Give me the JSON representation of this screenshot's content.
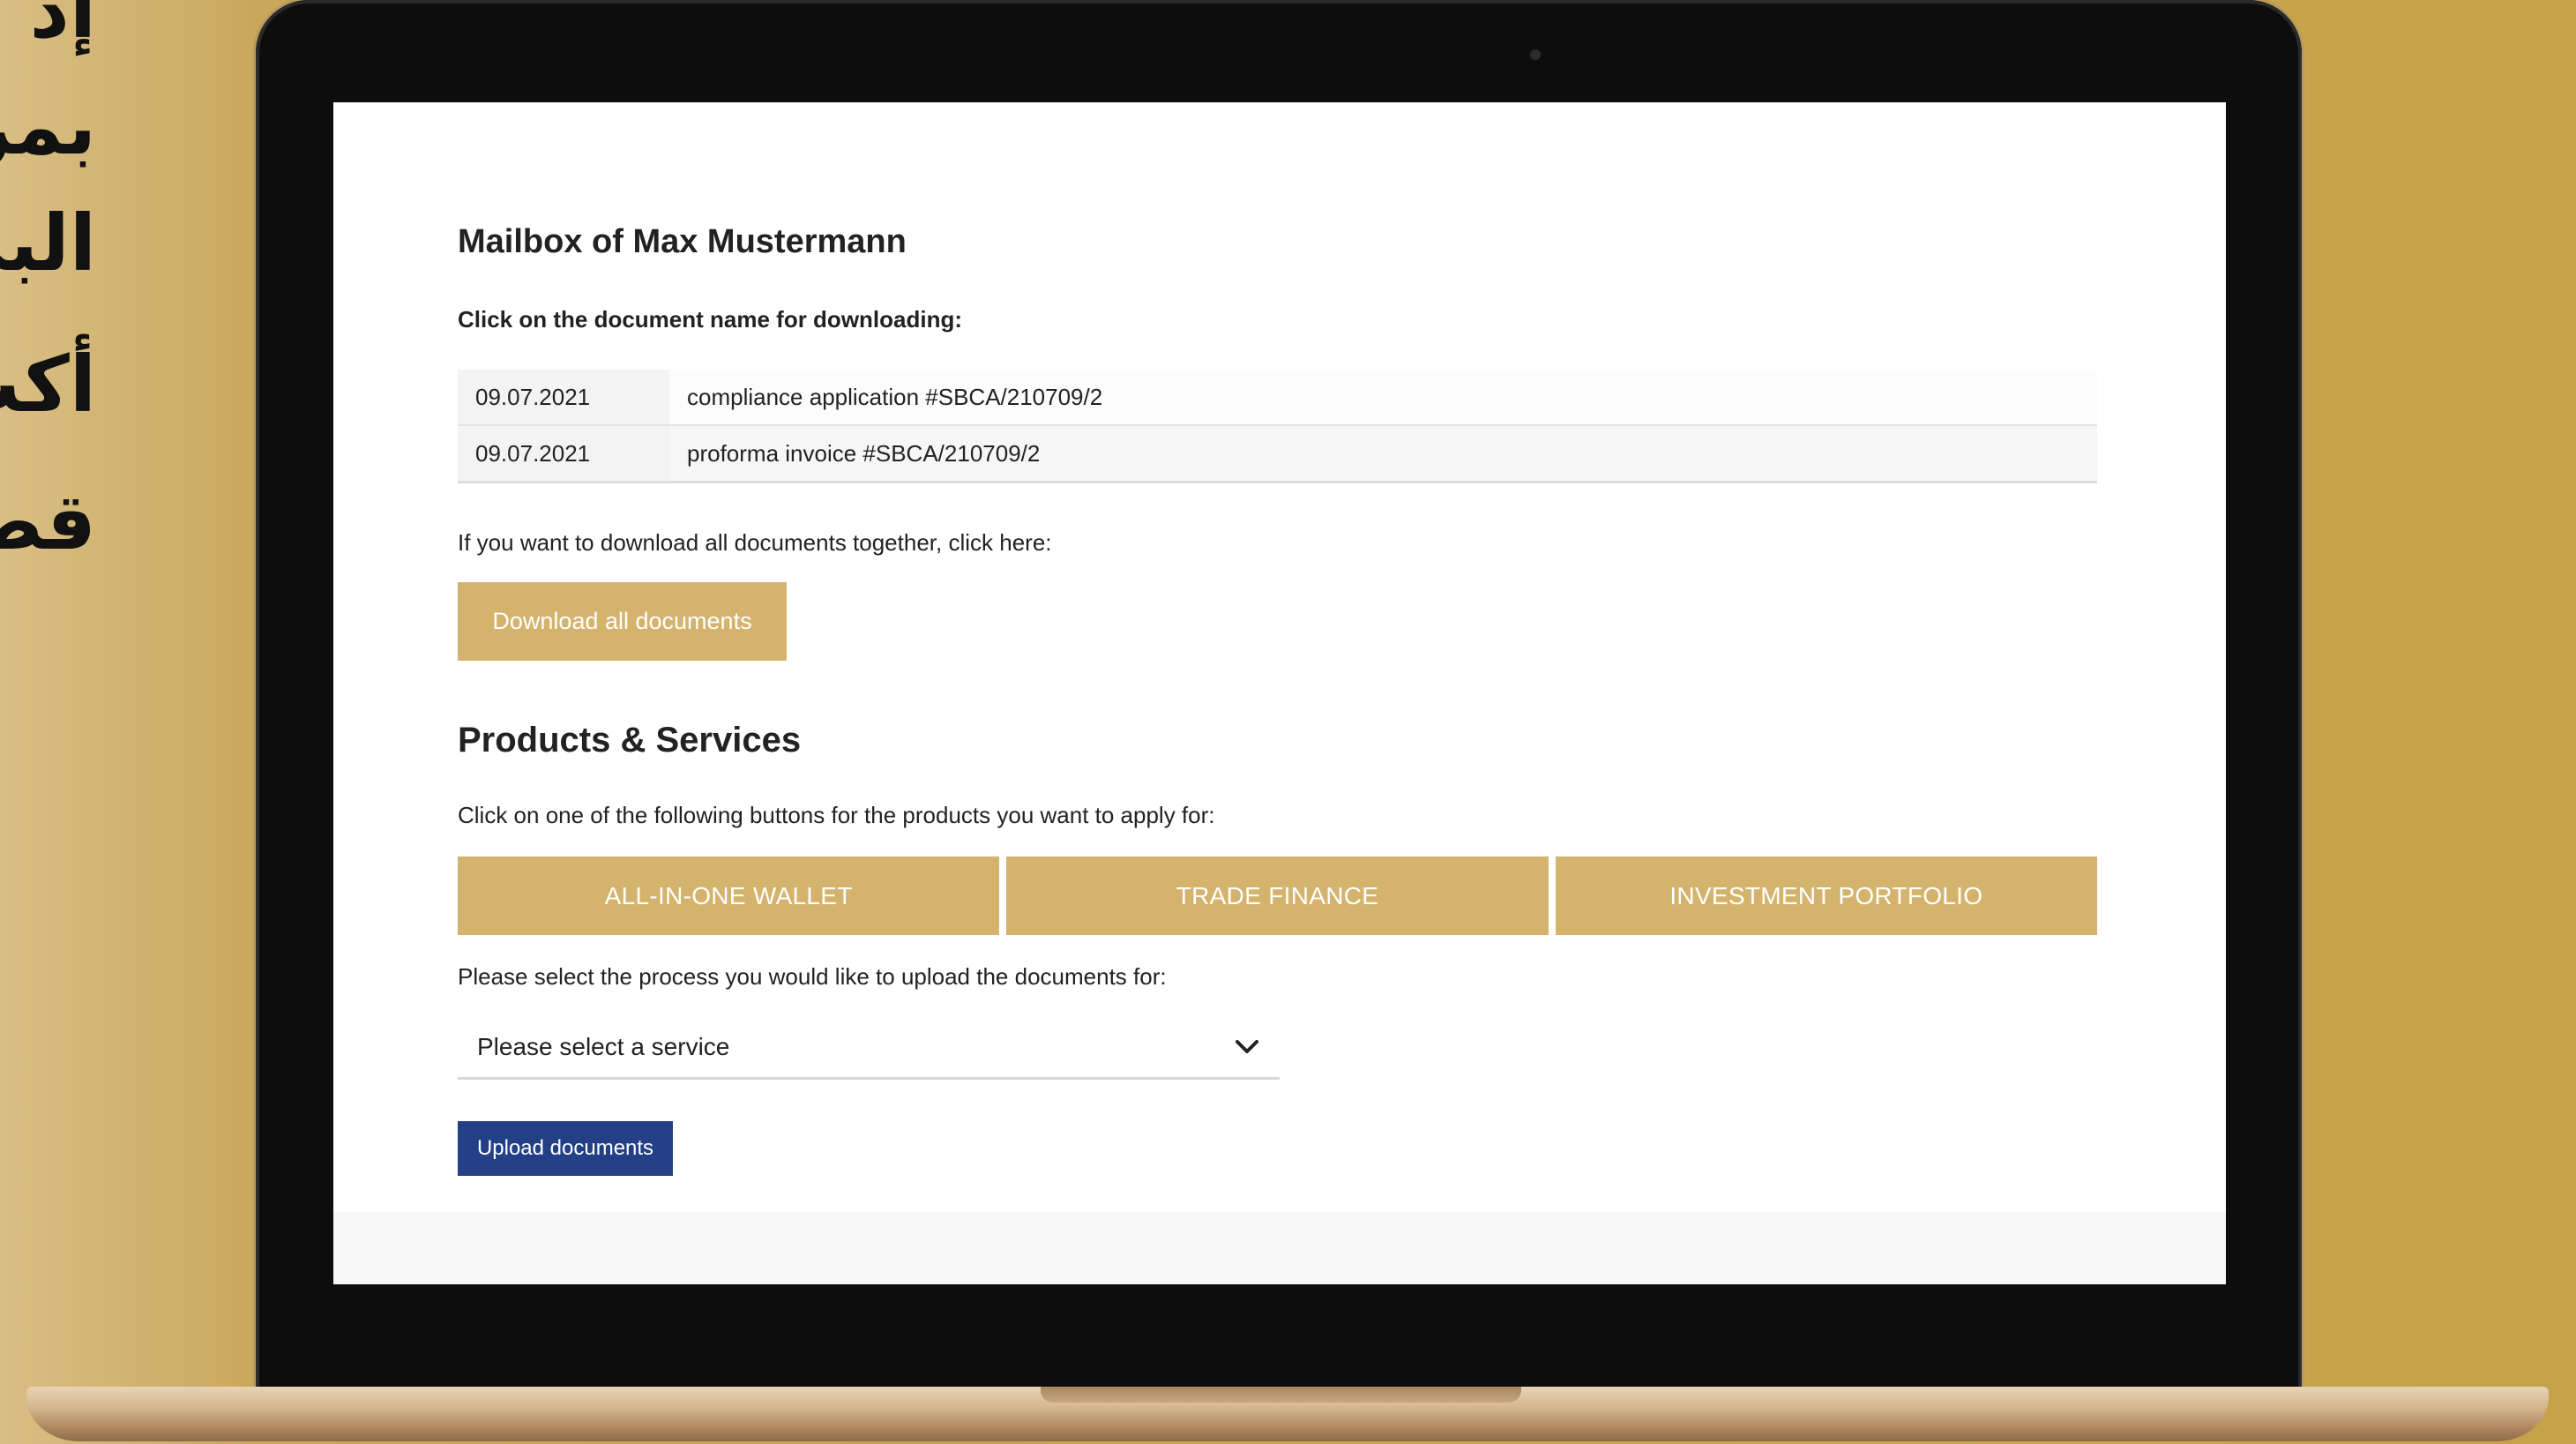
{
  "side_text": {
    "lines": [
      "إد",
      "بمر",
      "البن",
      "أكث",
      "قص"
    ]
  },
  "mailbox": {
    "title": "Mailbox of Max Mustermann",
    "instruction": "Click on the document name for downloading:",
    "documents": [
      {
        "date": "09.07.2021",
        "name": "compliance application #SBCA/210709/2"
      },
      {
        "date": "09.07.2021",
        "name": "proforma invoice #SBCA/210709/2"
      }
    ],
    "download_all_text": "If you want to download all documents together, click here:",
    "download_all_button": "Download all documents"
  },
  "products": {
    "title": "Products & Services",
    "instruction": "Click on one of the following buttons for the products you want to apply for:",
    "buttons": [
      "ALL-IN-ONE WALLET",
      "TRADE FINANCE",
      "INVESTMENT PORTFOLIO"
    ]
  },
  "upload": {
    "instruction": "Please select the process you would like to upload the documents for:",
    "select_value": "Please select a service",
    "button": "Upload documents"
  },
  "colors": {
    "gold": "#d4b36c",
    "navy": "#233f85",
    "background_gold": "#c5a353"
  }
}
